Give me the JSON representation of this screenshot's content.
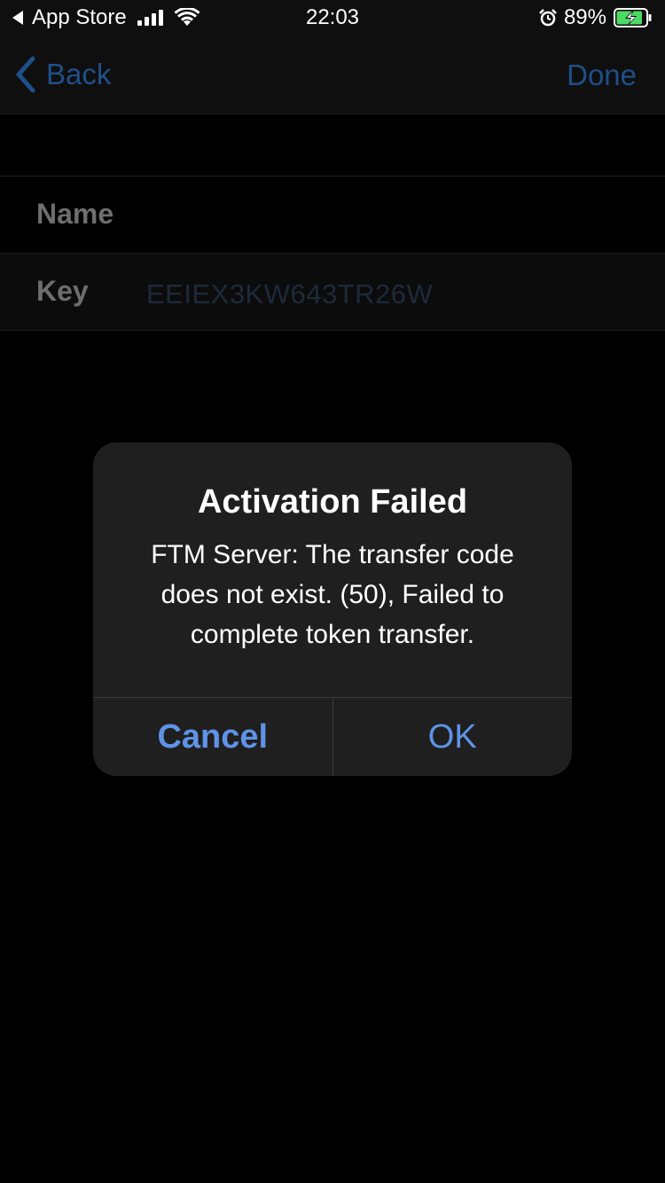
{
  "status_bar": {
    "back_app": "App Store",
    "time": "22:03",
    "battery_percent": "89%",
    "battery_level": 0.89,
    "charging": true,
    "icons": [
      "back-arrow-icon",
      "signal-icon",
      "wifi-icon",
      "alarm-icon",
      "battery-charging-icon"
    ]
  },
  "nav": {
    "back_label": "Back",
    "done_label": "Done",
    "accent_color": "#1f4f8a"
  },
  "form": {
    "name_label": "Name",
    "name_value": "",
    "key_label": "Key",
    "key_value": "EEIEX3KW643TR26W"
  },
  "alert": {
    "title": "Activation Failed",
    "message": "FTM Server: The transfer code does not exist. (50), Failed to complete token transfer.",
    "cancel_label": "Cancel",
    "ok_label": "OK",
    "button_color": "#5e93e6"
  }
}
